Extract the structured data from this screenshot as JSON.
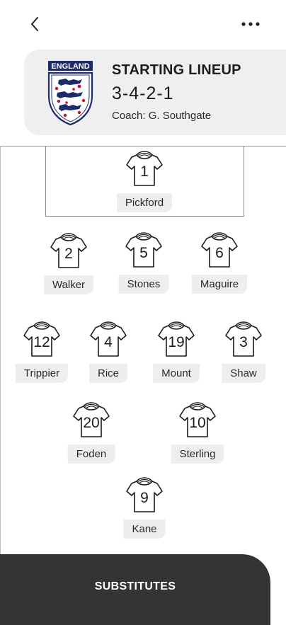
{
  "nav": {
    "back_icon": "chevron-left-icon",
    "more_icon": "more-horizontal-icon"
  },
  "header": {
    "crest_text": "ENGLAND",
    "title": "STARTING LINEUP",
    "formation": "3-4-2-1",
    "coach": "Coach: G. Southgate"
  },
  "lineup": {
    "goalkeeper": {
      "number": "1",
      "name": "Pickford"
    },
    "defenders": [
      {
        "number": "2",
        "name": "Walker"
      },
      {
        "number": "5",
        "name": "Stones"
      },
      {
        "number": "6",
        "name": "Maguire"
      }
    ],
    "midfielders": [
      {
        "number": "12",
        "name": "Trippier"
      },
      {
        "number": "4",
        "name": "Rice"
      },
      {
        "number": "19",
        "name": "Mount"
      },
      {
        "number": "3",
        "name": "Shaw"
      }
    ],
    "attacking_midfielders": [
      {
        "number": "20",
        "name": "Foden"
      },
      {
        "number": "10",
        "name": "Sterling"
      }
    ],
    "forward": {
      "number": "9",
      "name": "Kane"
    }
  },
  "substitutes": {
    "title": "SUBSTITUTES"
  },
  "colors": {
    "panel_dark": "#343434",
    "header_bg": "#efefef",
    "crest_navy": "#1d2b6b",
    "crest_red": "#c8102e"
  }
}
